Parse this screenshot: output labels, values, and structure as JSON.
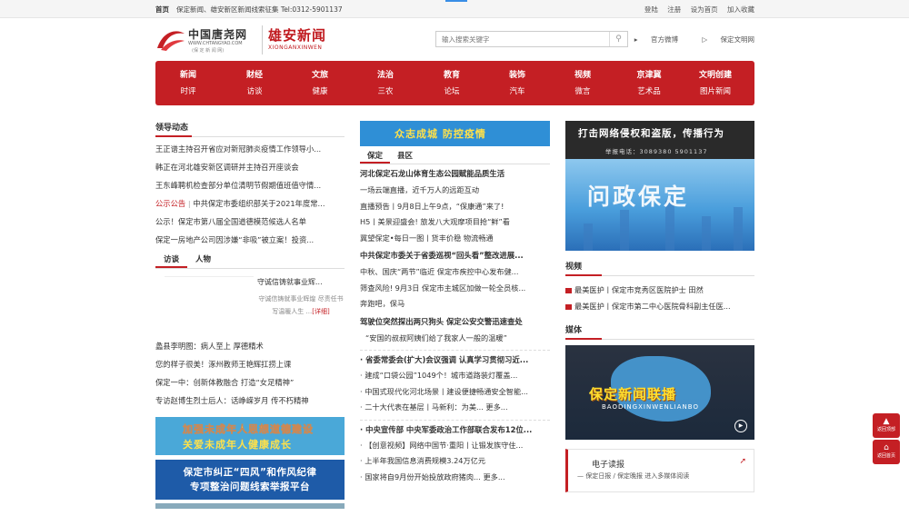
{
  "topbar": {
    "home": "首页",
    "notice": "保定新闻、雄安新区新闻线索征集 Tel:0312-5901137",
    "login": "登陆",
    "register": "注册",
    "sethome": "设为首页",
    "favorite": "加入收藏"
  },
  "logo": {
    "name": "中国唐尧网",
    "url": "WWW.CHTANGYAO.COM",
    "sub": "(保 定 新 闻 网)",
    "xiongan": "雄安新闻",
    "xiongan_en": "XIONGANXINWEN"
  },
  "search": {
    "placeholder": "输入搜索关键字"
  },
  "header_links": {
    "weibo": "官方微博",
    "civility": "保定文明网"
  },
  "nav": [
    {
      "main": "新闻",
      "sub": "时评"
    },
    {
      "main": "财经",
      "sub": "访谈"
    },
    {
      "main": "文旅",
      "sub": "健康"
    },
    {
      "main": "法治",
      "sub": "三农"
    },
    {
      "main": "教育",
      "sub": "论坛"
    },
    {
      "main": "装饰",
      "sub": "汽车"
    },
    {
      "main": "视频",
      "sub": "微言"
    },
    {
      "main": "京津冀",
      "sub": "艺术品"
    },
    {
      "main": "文明创建",
      "sub": "图片新闻"
    }
  ],
  "left": {
    "title": "领导动态",
    "items": [
      "王正谱主持召开省应对新冠肺炎疫情工作领导小...",
      "韩正在河北雄安新区调研并主持召开座谈会",
      "王东峰聘机检查部分单位清明节假期值班值守情..."
    ],
    "notice_label": "公示公告",
    "notice_sep": "|",
    "notice_first": "中共保定市委组织部关于2021年度常...",
    "notices": [
      "公示！保定市第八届全国道德模范候选人名单",
      "保定一房地产公司因涉嫌“非吸”被立案！投资..."
    ],
    "tabs": [
      "访谈",
      "人物"
    ],
    "interview_title": "守诚信铸就事业辉...",
    "interview_desc": "守诚信铸就事业辉煌 尽责任书写温暖人生",
    "interview_more": "...",
    "interview_detail": "[详细]",
    "people": [
      "蠡县李明图：病人至上 厚德精术",
      "您的样子很美！涿州教师王艳辉扛捞上课",
      "保定一中：创新体教融合 打造“女足精神”",
      "专访赵博生烈士后人：话峥嵘岁月 传不朽精神"
    ],
    "banner1_line1": "加强未成年人思想道德建设",
    "banner1_line2": "关爱未成年人健康成长",
    "banner2_line1": "保定市纠正“四风”和作风纪律",
    "banner2_line2": "专项整治问题线索举报平台"
  },
  "middle": {
    "banner": "众志成城 防控疫情",
    "tabs": [
      "保定",
      "县区"
    ],
    "headline1": "河北保定石龙山体育生态公园赋能品质生活",
    "list1": [
      "一场云端直播，近千万人的远距互动",
      "直播预告丨9月8日上午9点，“保康通”来了!",
      "H5丨美景迎盛会! 旅发八大观摩项目抢“鲜”看",
      "冀望保定•每日一图丨货丰价稳 物流畅通"
    ],
    "headline2": "中共保定市委关于省委巡视“回头看”整改进展...",
    "list2": [
      "中秋、国庆“两节”临近 保定市疾控中心发布健...",
      "筛查风险! 9月3日 保定市主城区加做一轮全员核...",
      "奔跑吧，保马"
    ],
    "headline3": "驾驶位突然探出两只狗头 保定公安交警迅速查处",
    "quote": "“安国的叔叔阿姨们给了我家人一般的温暖”",
    "headline4": "· 省委常委会(扩大)会议强调 认真学习贯彻习近...",
    "list3": [
      "· 建成“口袋公园”1049个！城市道路装灯覆盖...",
      "· 中国式现代化河北场景丨建设便捷畅通安全智能...",
      "· 二十大代表在基层丨马新利：为美...      更多..."
    ],
    "headline5": "· 中央宣传部 中央军委政治工作部联合发布12位...",
    "list4": [
      "· 【创意视频】网络中国节·重阳丨让锻发族守住...",
      "· 上半年我国信息消费规模3.24万亿元",
      "· 国家将自9月份开始投放政府猪肉...      更多..."
    ]
  },
  "right": {
    "rb1_line1": "打击网络侵权和盗版，传播行为",
    "rb1_line2": "举报电话：3089380  5901137",
    "wenzheng": "问政保定",
    "video_title": "视频",
    "videos": [
      "最美医护丨保定市竞秀区医院护士 田然",
      "最美医护丨保定市第二中心医院骨科副主任医..."
    ],
    "media_title": "媒体",
    "lianbo": "保定新闻联播",
    "lianbo_en": "BAODINGXINWENLIANBO",
    "epaper_title": "电子读报",
    "epaper_sub": "— 保定日报 / 保定晚报 进入多媒体阅读"
  },
  "float": {
    "top": "返回顶部",
    "home": "返回首页"
  }
}
